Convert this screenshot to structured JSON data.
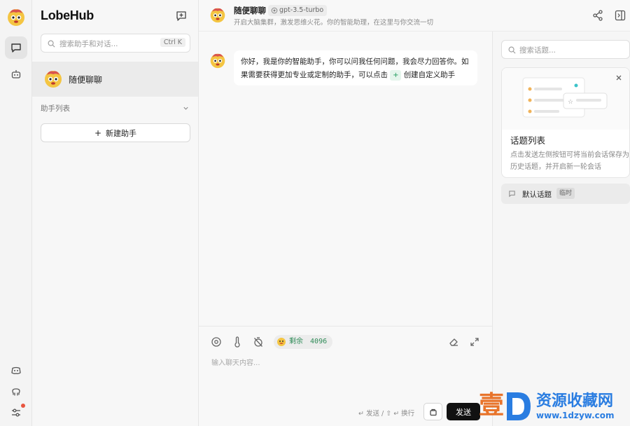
{
  "app": {
    "brand": "LobeHub"
  },
  "sessions": {
    "search_placeholder": "搜索助手和对话...",
    "search_shortcut": "Ctrl K",
    "active_session": "随便聊聊",
    "assistant_list_label": "助手列表",
    "create_assistant_label": "新建助手"
  },
  "chat": {
    "title": "随便聊聊",
    "model": "gpt-3.5-turbo",
    "description": "开启大脑集群，激发思维火花。你的智能助理，在这里与你交流一切",
    "message_part1": "你好，我是你的智能助手，你可以问我任何问题，我会尽力回答你。如果需要获得更加专业或定制的助手，可以点击",
    "message_chip": "+",
    "message_part2": "创建自定义助手"
  },
  "input": {
    "token_label": "剩余",
    "token_count": "4096",
    "placeholder": "输入聊天内容...",
    "send_hint": "↵ 发送 / ⇧ ↵ 换行",
    "send_label": "发送"
  },
  "topics": {
    "search_placeholder": "搜索话题...",
    "card_title": "话题列表",
    "card_desc": "点击发送左侧按钮可将当前会话保存为历史话题，并开启新一轮会话",
    "default_topic": "默认话题",
    "default_badge": "临时"
  },
  "watermark": {
    "main": "壹D资源收藏网",
    "url": "www.1dzyw.com"
  },
  "colors": {
    "accent_green": "#1e9b5b",
    "send_button": "#111111",
    "notify_dot": "#e8553f"
  }
}
